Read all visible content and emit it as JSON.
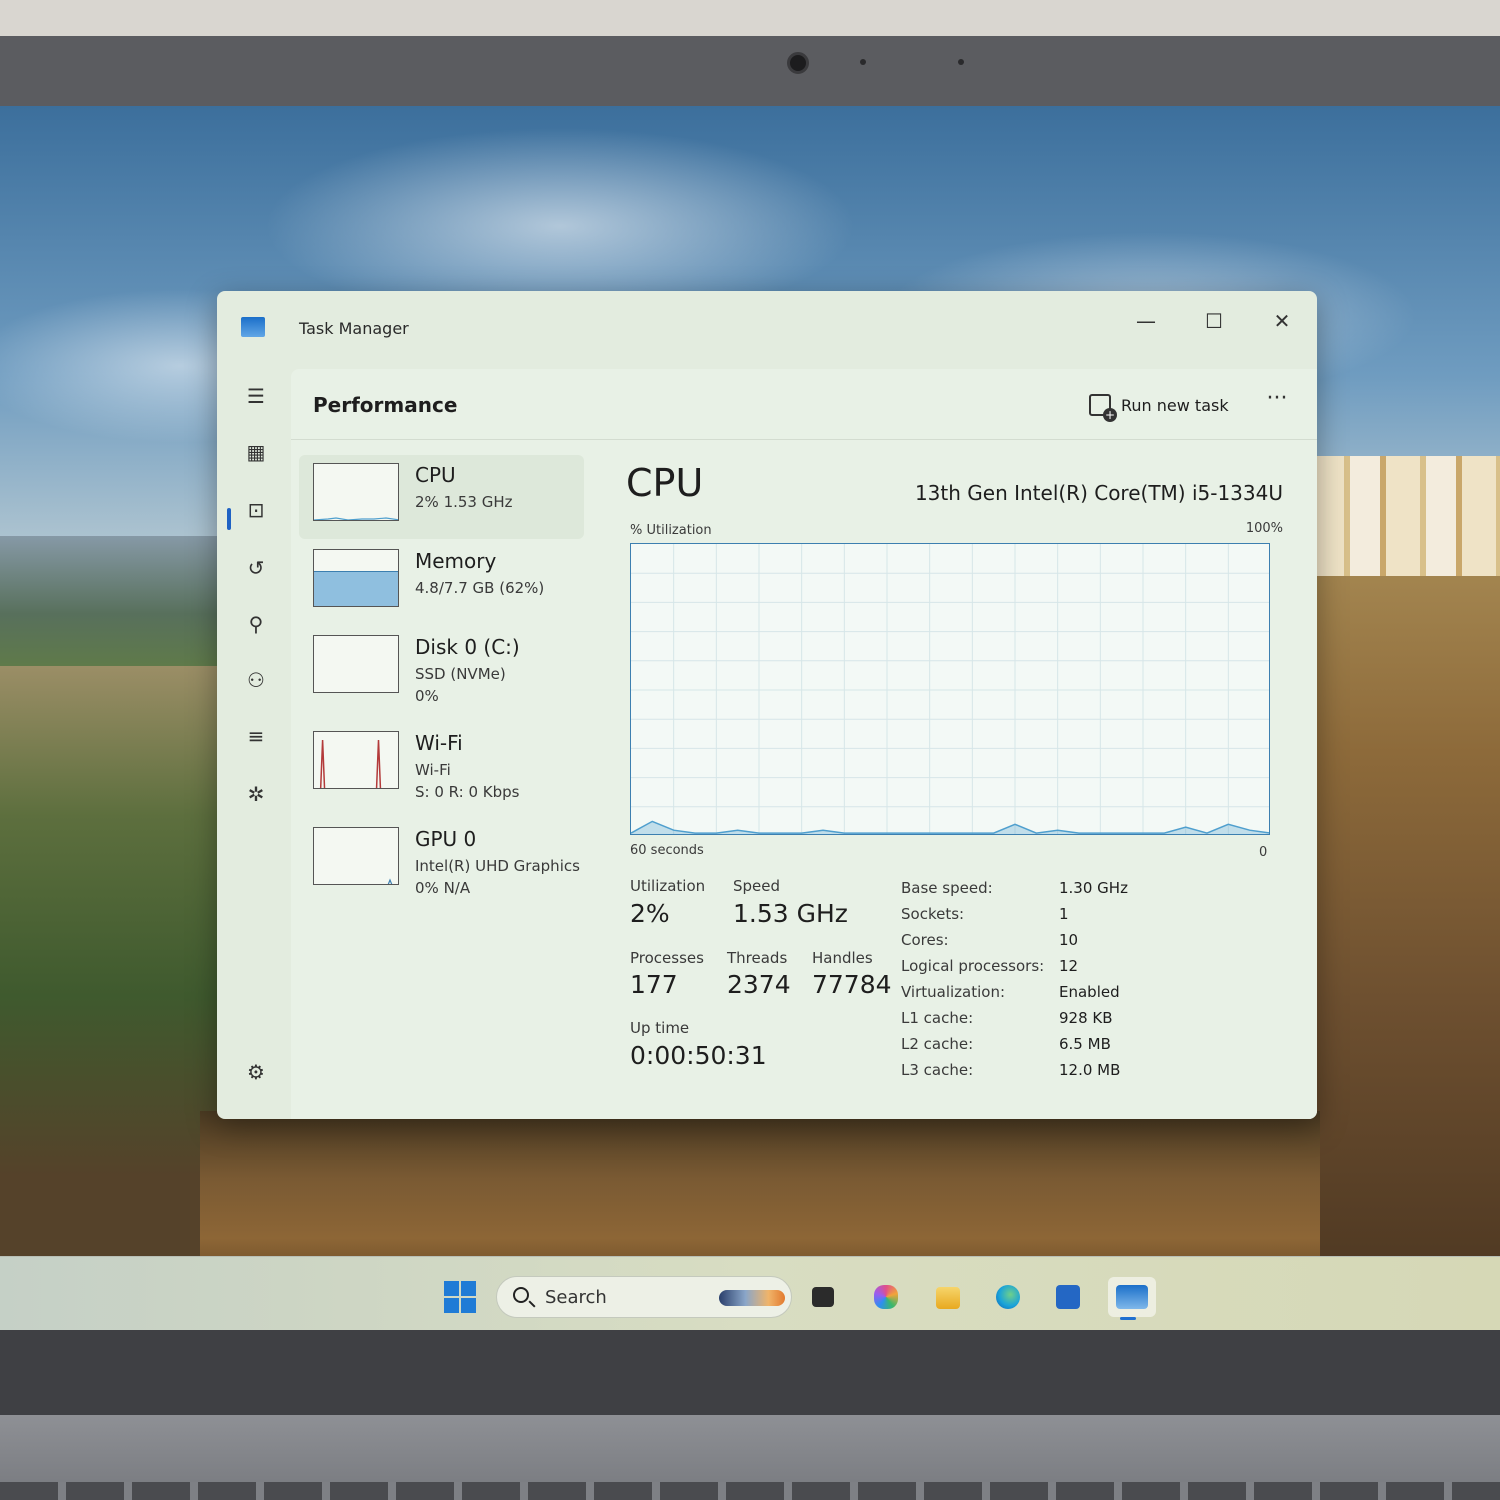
{
  "window": {
    "title": "Task Manager",
    "controls": {
      "minimize": "—",
      "maximize": "☐",
      "close": "✕"
    }
  },
  "header": {
    "title": "Performance",
    "run_new_task": "Run new task",
    "more": "···"
  },
  "sidebar": {
    "icons": [
      "hamburger-icon",
      "processes-icon",
      "performance-icon",
      "app-history-icon",
      "startup-apps-icon",
      "users-icon",
      "details-icon",
      "services-icon",
      "settings-icon"
    ],
    "active": "performance-icon"
  },
  "devices": [
    {
      "name": "CPU",
      "line1": "2%  1.53 GHz",
      "line2": "",
      "selected": true
    },
    {
      "name": "Memory",
      "line1": "4.8/7.7 GB (62%)",
      "line2": "",
      "selected": false
    },
    {
      "name": "Disk 0 (C:)",
      "line1": "SSD (NVMe)",
      "line2": "0%",
      "selected": false
    },
    {
      "name": "Wi-Fi",
      "line1": "Wi-Fi",
      "line2": "S: 0 R: 0 Kbps",
      "selected": false
    },
    {
      "name": "GPU 0",
      "line1": "Intel(R) UHD Graphics",
      "line2": "0%  N/A",
      "selected": false
    }
  ],
  "detail": {
    "title": "CPU",
    "model": "13th Gen Intel(R) Core(TM) i5-1334U",
    "graph_label": "% Utilization",
    "graph_max": "100%",
    "graph_time": "60 seconds",
    "graph_min": "0",
    "stats": {
      "utilization_label": "Utilization",
      "utilization": "2%",
      "speed_label": "Speed",
      "speed": "1.53 GHz",
      "processes_label": "Processes",
      "processes": "177",
      "threads_label": "Threads",
      "threads": "2374",
      "handles_label": "Handles",
      "handles": "77784",
      "uptime_label": "Up time",
      "uptime": "0:00:50:31"
    },
    "specs": [
      {
        "label": "Base speed:",
        "value": "1.30 GHz"
      },
      {
        "label": "Sockets:",
        "value": "1"
      },
      {
        "label": "Cores:",
        "value": "10"
      },
      {
        "label": "Logical processors:",
        "value": "12"
      },
      {
        "label": "Virtualization:",
        "value": "Enabled"
      },
      {
        "label": "L1 cache:",
        "value": "928 KB"
      },
      {
        "label": "L2 cache:",
        "value": "6.5 MB"
      },
      {
        "label": "L3 cache:",
        "value": "12.0 MB"
      }
    ]
  },
  "chart_data": {
    "type": "area",
    "x": [
      0,
      2,
      4,
      6,
      8,
      10,
      12,
      14,
      16,
      18,
      20,
      22,
      24,
      26,
      28,
      30,
      32,
      34,
      36,
      38,
      40,
      42,
      44,
      46,
      48,
      50,
      52,
      54,
      56,
      58,
      60
    ],
    "values": [
      1,
      5,
      2,
      1,
      1,
      2,
      1,
      1,
      1,
      2,
      1,
      1,
      1,
      1,
      1,
      1,
      1,
      1,
      4,
      1,
      2,
      1,
      1,
      1,
      1,
      1,
      3,
      1,
      4,
      2,
      1
    ],
    "xlabel": "60 seconds",
    "ylabel": "% Utilization",
    "ylim": [
      0,
      100
    ],
    "grid": true,
    "color": "#4f9fce"
  },
  "mini_graphs": {
    "memory_fill": 0.62,
    "wifi_spikes": [
      0.1,
      0.75
    ]
  },
  "taskbar": {
    "search_text": "Search",
    "apps": [
      "start-icon",
      "search-icon",
      "task-view-icon",
      "copilot-icon",
      "file-explorer-icon",
      "edge-icon",
      "store-icon",
      "task-manager-icon"
    ],
    "colors": {
      "start": "#1f7bd6",
      "explorer": "#f2c230",
      "edge": "#1aa3d9",
      "store": "#2467c4",
      "task_manager": "#1f6fd0"
    }
  }
}
